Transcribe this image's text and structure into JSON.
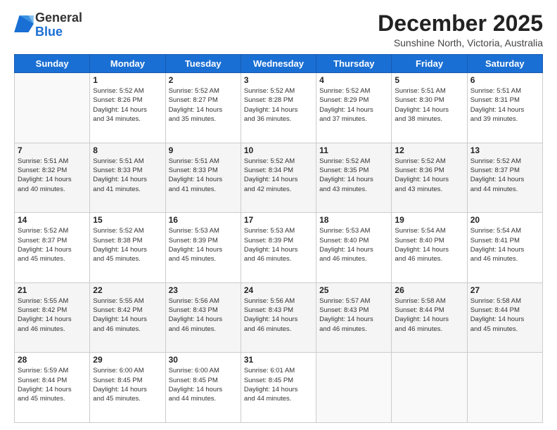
{
  "header": {
    "logo_general": "General",
    "logo_blue": "Blue",
    "month_title": "December 2025",
    "subtitle": "Sunshine North, Victoria, Australia"
  },
  "days_of_week": [
    "Sunday",
    "Monday",
    "Tuesday",
    "Wednesday",
    "Thursday",
    "Friday",
    "Saturday"
  ],
  "weeks": [
    [
      {
        "day": "",
        "content": ""
      },
      {
        "day": "1",
        "content": "Sunrise: 5:52 AM\nSunset: 8:26 PM\nDaylight: 14 hours\nand 34 minutes."
      },
      {
        "day": "2",
        "content": "Sunrise: 5:52 AM\nSunset: 8:27 PM\nDaylight: 14 hours\nand 35 minutes."
      },
      {
        "day": "3",
        "content": "Sunrise: 5:52 AM\nSunset: 8:28 PM\nDaylight: 14 hours\nand 36 minutes."
      },
      {
        "day": "4",
        "content": "Sunrise: 5:52 AM\nSunset: 8:29 PM\nDaylight: 14 hours\nand 37 minutes."
      },
      {
        "day": "5",
        "content": "Sunrise: 5:51 AM\nSunset: 8:30 PM\nDaylight: 14 hours\nand 38 minutes."
      },
      {
        "day": "6",
        "content": "Sunrise: 5:51 AM\nSunset: 8:31 PM\nDaylight: 14 hours\nand 39 minutes."
      }
    ],
    [
      {
        "day": "7",
        "content": "Sunrise: 5:51 AM\nSunset: 8:32 PM\nDaylight: 14 hours\nand 40 minutes."
      },
      {
        "day": "8",
        "content": "Sunrise: 5:51 AM\nSunset: 8:33 PM\nDaylight: 14 hours\nand 41 minutes."
      },
      {
        "day": "9",
        "content": "Sunrise: 5:51 AM\nSunset: 8:33 PM\nDaylight: 14 hours\nand 41 minutes."
      },
      {
        "day": "10",
        "content": "Sunrise: 5:52 AM\nSunset: 8:34 PM\nDaylight: 14 hours\nand 42 minutes."
      },
      {
        "day": "11",
        "content": "Sunrise: 5:52 AM\nSunset: 8:35 PM\nDaylight: 14 hours\nand 43 minutes."
      },
      {
        "day": "12",
        "content": "Sunrise: 5:52 AM\nSunset: 8:36 PM\nDaylight: 14 hours\nand 43 minutes."
      },
      {
        "day": "13",
        "content": "Sunrise: 5:52 AM\nSunset: 8:37 PM\nDaylight: 14 hours\nand 44 minutes."
      }
    ],
    [
      {
        "day": "14",
        "content": "Sunrise: 5:52 AM\nSunset: 8:37 PM\nDaylight: 14 hours\nand 45 minutes."
      },
      {
        "day": "15",
        "content": "Sunrise: 5:52 AM\nSunset: 8:38 PM\nDaylight: 14 hours\nand 45 minutes."
      },
      {
        "day": "16",
        "content": "Sunrise: 5:53 AM\nSunset: 8:39 PM\nDaylight: 14 hours\nand 45 minutes."
      },
      {
        "day": "17",
        "content": "Sunrise: 5:53 AM\nSunset: 8:39 PM\nDaylight: 14 hours\nand 46 minutes."
      },
      {
        "day": "18",
        "content": "Sunrise: 5:53 AM\nSunset: 8:40 PM\nDaylight: 14 hours\nand 46 minutes."
      },
      {
        "day": "19",
        "content": "Sunrise: 5:54 AM\nSunset: 8:40 PM\nDaylight: 14 hours\nand 46 minutes."
      },
      {
        "day": "20",
        "content": "Sunrise: 5:54 AM\nSunset: 8:41 PM\nDaylight: 14 hours\nand 46 minutes."
      }
    ],
    [
      {
        "day": "21",
        "content": "Sunrise: 5:55 AM\nSunset: 8:42 PM\nDaylight: 14 hours\nand 46 minutes."
      },
      {
        "day": "22",
        "content": "Sunrise: 5:55 AM\nSunset: 8:42 PM\nDaylight: 14 hours\nand 46 minutes."
      },
      {
        "day": "23",
        "content": "Sunrise: 5:56 AM\nSunset: 8:43 PM\nDaylight: 14 hours\nand 46 minutes."
      },
      {
        "day": "24",
        "content": "Sunrise: 5:56 AM\nSunset: 8:43 PM\nDaylight: 14 hours\nand 46 minutes."
      },
      {
        "day": "25",
        "content": "Sunrise: 5:57 AM\nSunset: 8:43 PM\nDaylight: 14 hours\nand 46 minutes."
      },
      {
        "day": "26",
        "content": "Sunrise: 5:58 AM\nSunset: 8:44 PM\nDaylight: 14 hours\nand 46 minutes."
      },
      {
        "day": "27",
        "content": "Sunrise: 5:58 AM\nSunset: 8:44 PM\nDaylight: 14 hours\nand 45 minutes."
      }
    ],
    [
      {
        "day": "28",
        "content": "Sunrise: 5:59 AM\nSunset: 8:44 PM\nDaylight: 14 hours\nand 45 minutes."
      },
      {
        "day": "29",
        "content": "Sunrise: 6:00 AM\nSunset: 8:45 PM\nDaylight: 14 hours\nand 45 minutes."
      },
      {
        "day": "30",
        "content": "Sunrise: 6:00 AM\nSunset: 8:45 PM\nDaylight: 14 hours\nand 44 minutes."
      },
      {
        "day": "31",
        "content": "Sunrise: 6:01 AM\nSunset: 8:45 PM\nDaylight: 14 hours\nand 44 minutes."
      },
      {
        "day": "",
        "content": ""
      },
      {
        "day": "",
        "content": ""
      },
      {
        "day": "",
        "content": ""
      }
    ]
  ]
}
